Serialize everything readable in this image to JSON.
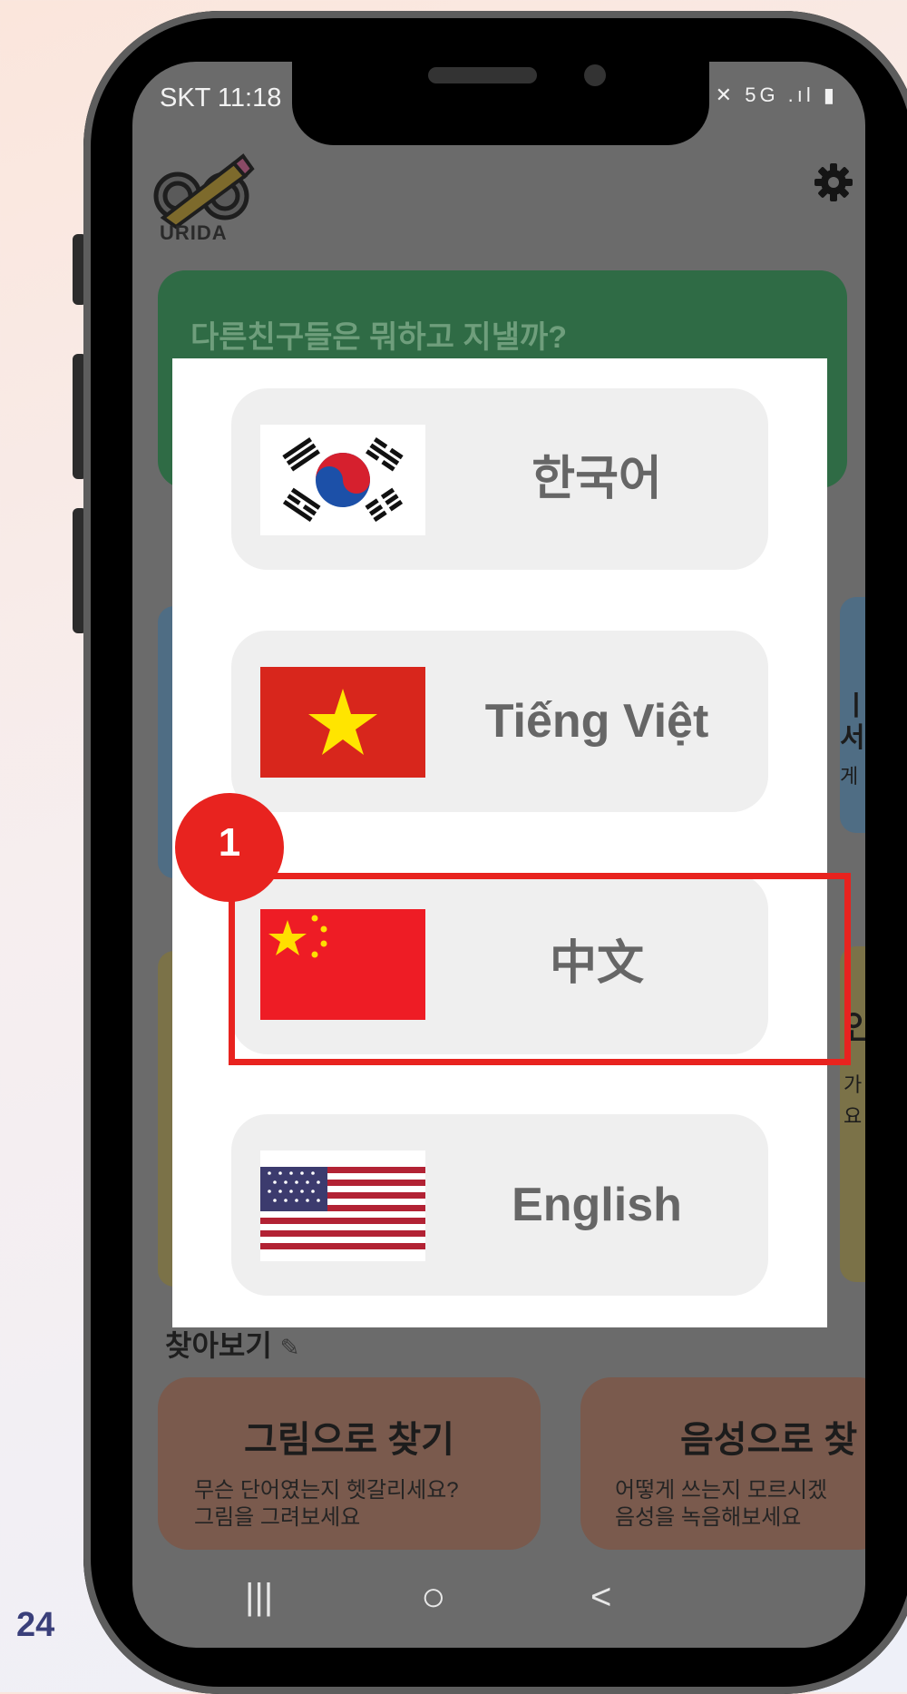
{
  "page_number": "24",
  "status_bar": {
    "time": "SKT 11:18",
    "icons": "✕ 5G .ıl ▮"
  },
  "app": {
    "logo_text": "URIDA",
    "banner_text": "다른친구들은 뭐하고 지낼까?",
    "peek_text_1": "ㅣ",
    "peek_text_2": "서브",
    "peek_text_3": "게",
    "peek_text_4": "인",
    "peek_text_5": "가",
    "peek_text_6": "요",
    "section_title": "찾아보기",
    "tiles": [
      {
        "title": "그림으로 찾기",
        "desc": "무슨 단어였는지 헷갈리세요?\n그림을 그려보세요"
      },
      {
        "title": "음성으로 찾",
        "desc": "어떻게 쓰는지 모르시겠\n음성을 녹음해보세요"
      }
    ]
  },
  "language_dialog": {
    "options": [
      {
        "label": "한국어",
        "flag": "korea-flag"
      },
      {
        "label": "Tiếng Việt",
        "flag": "vietnam-flag"
      },
      {
        "label": "中文",
        "flag": "china-flag"
      },
      {
        "label": "English",
        "flag": "usa-flag"
      }
    ]
  },
  "annotation": {
    "step": "1",
    "highlight_color": "#e8231f"
  },
  "navbar": {
    "recents": "|||",
    "home": "○",
    "back": "<"
  }
}
